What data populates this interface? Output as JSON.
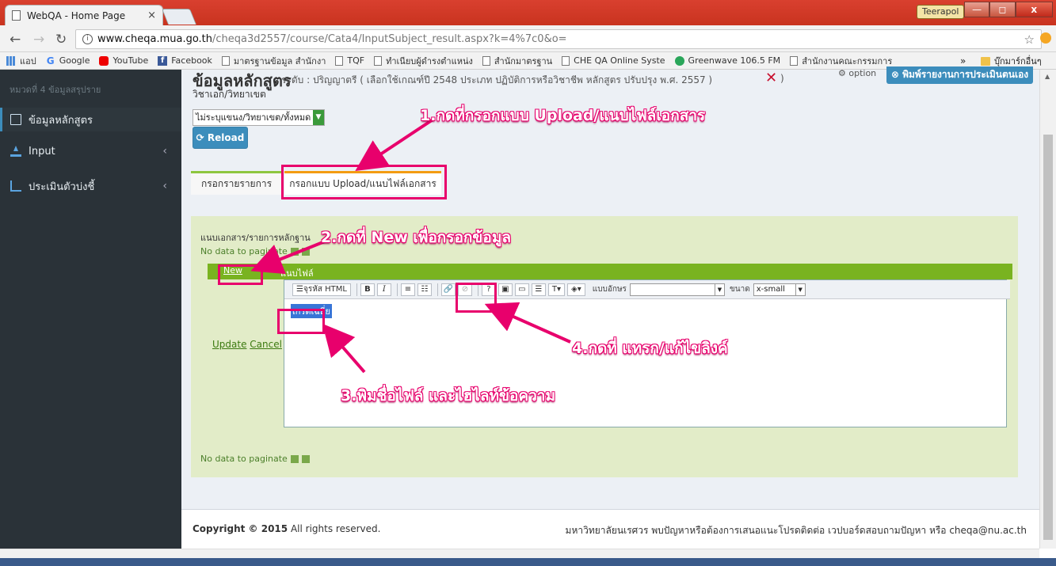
{
  "browser": {
    "tab_title": "WebQA - Home Page",
    "tab_close": "×",
    "user_badge": "Teerapol",
    "win_min": "—",
    "win_max": "◻",
    "win_close": "x",
    "url_host": "www.cheqa.mua.go.th",
    "url_path": "/cheqa3d2557/course/Cata4/InputSubject_result.aspx?k=4%7c0&o=",
    "bookmarks": [
      {
        "label": "แอป",
        "icon": "apps-icon"
      },
      {
        "label": "Google",
        "icon": "google-icon"
      },
      {
        "label": "YouTube",
        "icon": "youtube-icon"
      },
      {
        "label": "Facebook",
        "icon": "facebook-icon"
      },
      {
        "label": "มาตรฐานข้อมูล สำนักงา",
        "icon": "page-icon"
      },
      {
        "label": "TQF",
        "icon": "page-icon"
      },
      {
        "label": "ทำเนียบผู้ดำรงตำแหน่ง",
        "icon": "page-icon"
      },
      {
        "label": "สำนักมาตรฐาน",
        "icon": "page-icon"
      },
      {
        "label": "CHE QA Online Syste",
        "icon": "page-icon"
      },
      {
        "label": "Greenwave 106.5 FM",
        "icon": "greenwave-icon"
      },
      {
        "label": "สำนักงานคณะกรรมการ",
        "icon": "page-icon"
      }
    ],
    "bookmarks_more": "»",
    "other_bookmarks": "บุ๊กมาร์กอื่นๆ"
  },
  "sidebar": {
    "section_title": "หมวดที่ 4 ข้อมูลสรุปราย",
    "items": [
      {
        "label": "ข้อมูลหลักสูตร",
        "icon": "file-icon",
        "chevron": ""
      },
      {
        "label": "Input",
        "icon": "upload-icon",
        "chevron": "‹"
      },
      {
        "label": "ประเมินตัวบ่งชี้",
        "icon": "line-chart-icon",
        "chevron": "‹"
      }
    ]
  },
  "main": {
    "title": "ข้อมูลหลักสูตร",
    "subtitle": "ระดับ : ปริญญาตรี ( เลือกใช้เกณฑ์ปี 2548 ประเภท ปฏิบัติการหรือวิชาชีพ หลักสูตร ปรับปรุง พ.ศ. 2557 )",
    "x_mark": "✕",
    "close_paren": ")",
    "line2": "วิชาเอก/วิทยาเขต",
    "option_link": "option",
    "print_button": "พิมพ์รายงานการประเมินตนเอง",
    "select_value": "ไม่ระบุแขนง/วิทยาเขต/ทั้งหมด",
    "reload_button": "Reload",
    "tabs": [
      "กรอกรายรายการ",
      "กรอกแบบ Upload/แนบไฟล์เอกสาร"
    ],
    "doc_label": "แนบเอกสาร/รายการหลักฐาน",
    "no_data": "No data to paginate",
    "new_link": "New",
    "attach_header": "แนบไฟล์",
    "update_link": "Update",
    "cancel_link": "Cancel",
    "editor_text": "เกรดเฉลี่ย",
    "toolbar": {
      "html_label": "จุรหัส HTML",
      "font_label": "แบบอักษร",
      "size_label": "ขนาด",
      "size_value": "x-small"
    }
  },
  "footer": {
    "copyright_bold": "Copyright © 2015",
    "copyright_rest": " All rights reserved.",
    "right_text": "มหาวิทยาลัยนเรศวร พบปัญหาหรือต้องการเสนอแนะโปรดติดต่อ เวปบอร์ดสอบถามปัญหา หรือ cheqa@nu.ac.th"
  },
  "annotations": {
    "step1": "1.กดที่กรอกแบบ Upload/แนบไฟล์เอกสาร",
    "step2": "2.กดที่ New เพื่อกรอกข้อมูล",
    "step3": "3.พิมชื่อไฟล์ และไฮไลท์ข้อความ",
    "step4": "4.กดที่ แทรก/แก้ไขลิงค์"
  },
  "colors": {
    "accent": "#3c8dbc",
    "annotation": "#e8006c",
    "grid_header": "#79b320"
  }
}
